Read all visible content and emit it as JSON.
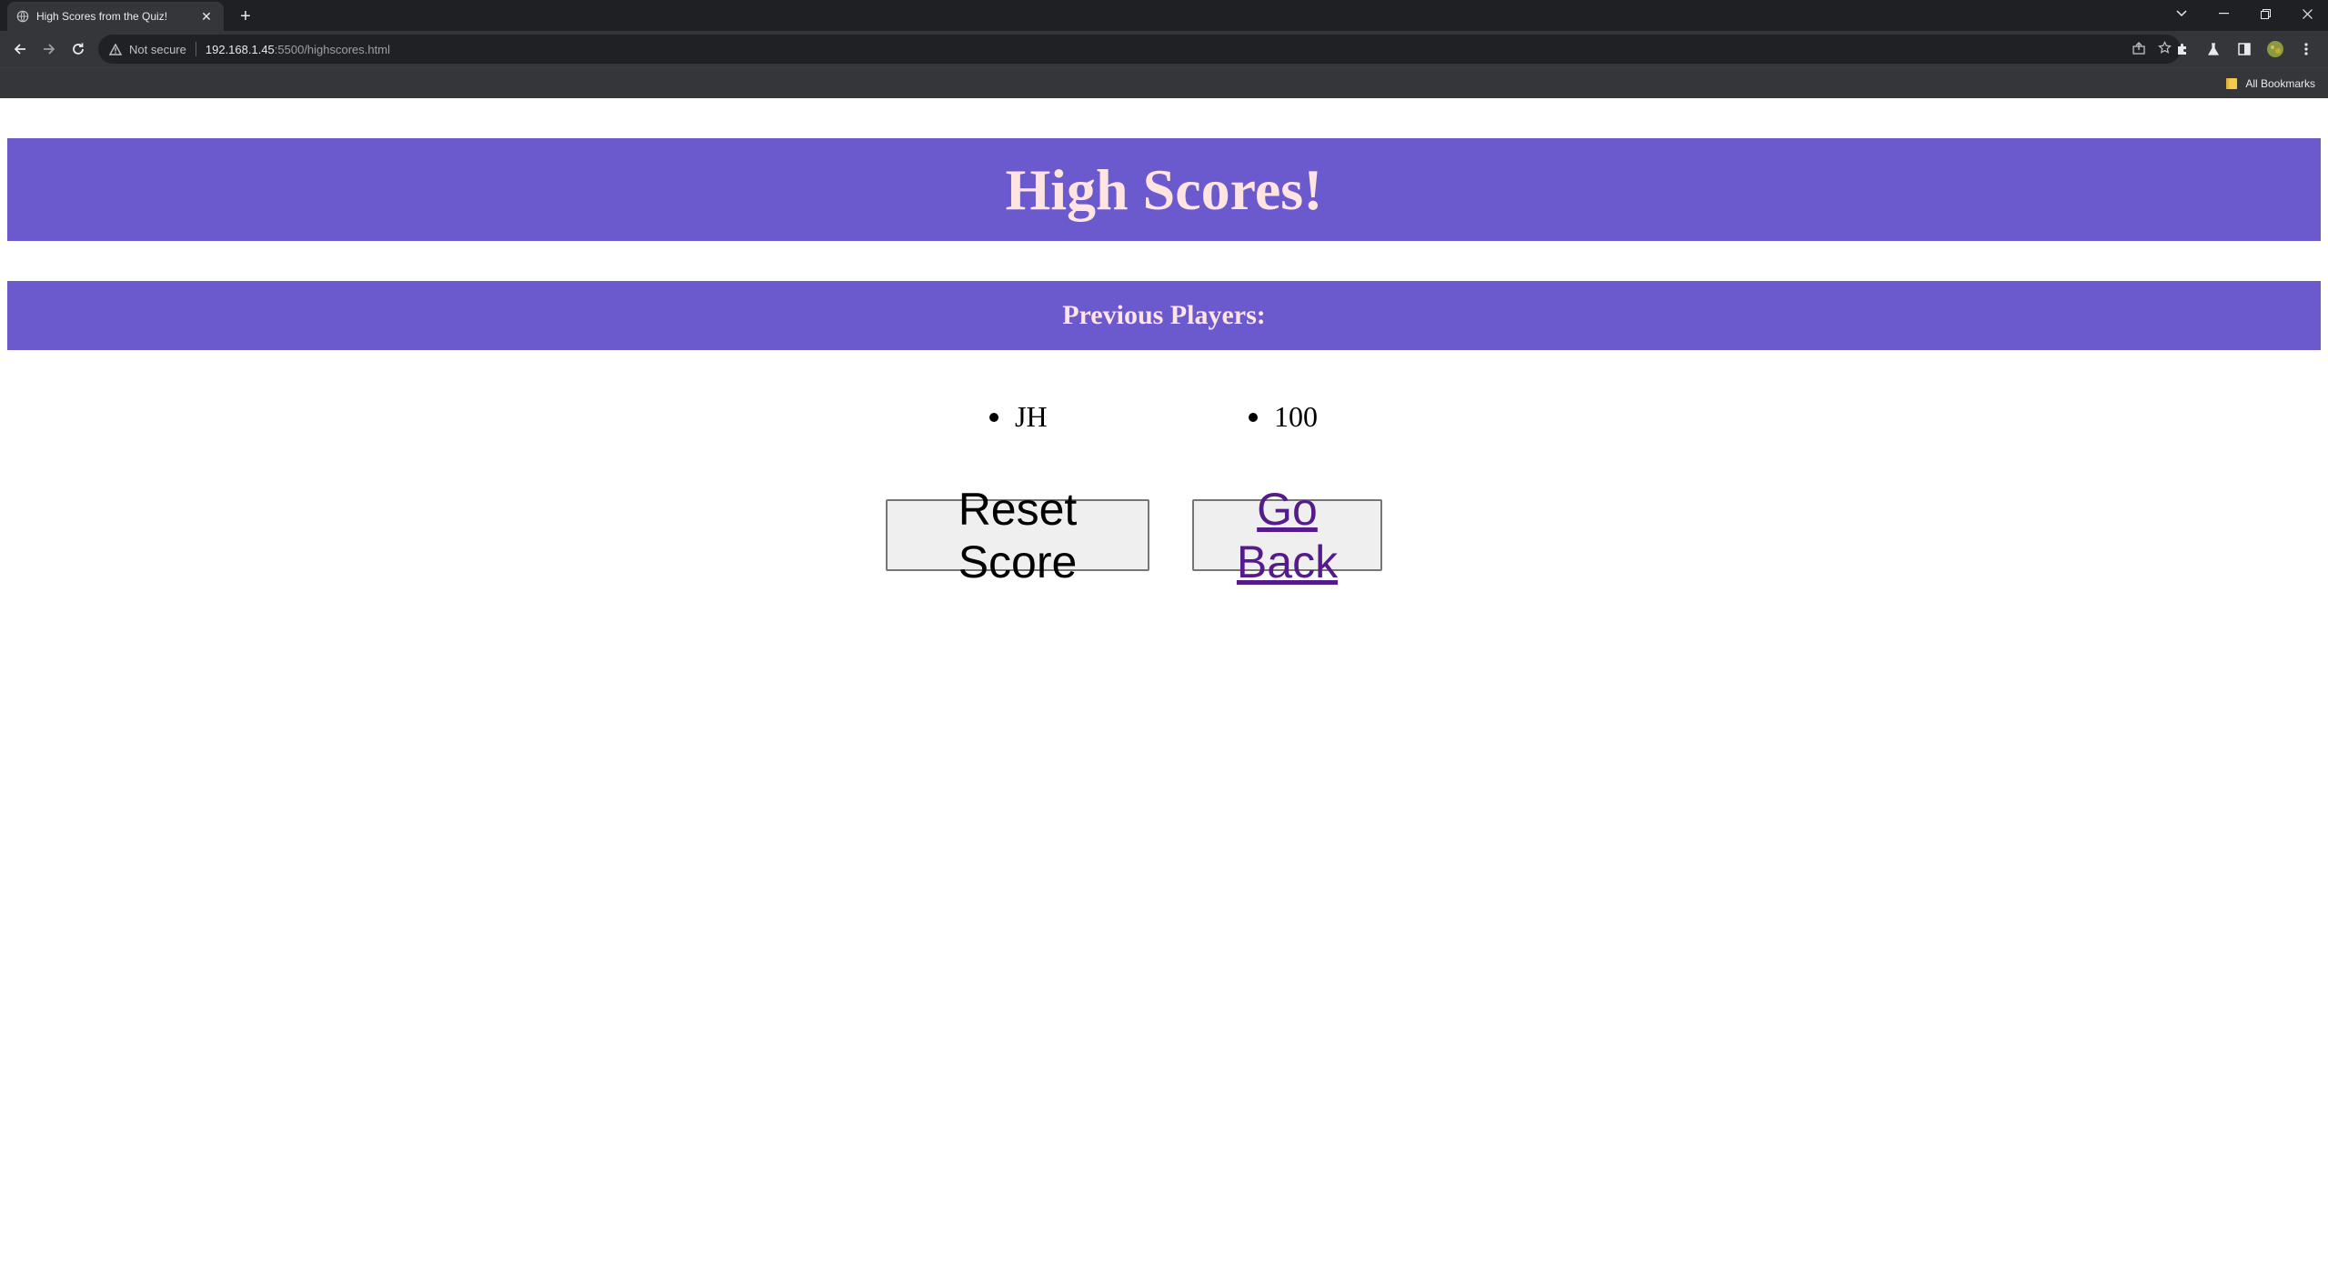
{
  "browser": {
    "tab": {
      "title": "High Scores from the Quiz!"
    },
    "address_bar": {
      "security_label": "Not secure",
      "url_host": "192.168.1.45",
      "url_rest": ":5500/highscores.html"
    },
    "bookmarks": {
      "all_bookmarks_label": "All Bookmarks"
    }
  },
  "page": {
    "title": "High Scores!",
    "subtitle": "Previous Players:",
    "players": [
      {
        "initials": "JH",
        "score": "100"
      }
    ],
    "buttons": {
      "reset": "Reset Score",
      "back": "Go Back"
    }
  },
  "colors": {
    "banner_bg": "#6a5acd",
    "banner_text": "#ffe4e1",
    "link": "#551a8b",
    "chrome_dark": "#1f2023",
    "chrome_toolbar": "#35363a"
  }
}
